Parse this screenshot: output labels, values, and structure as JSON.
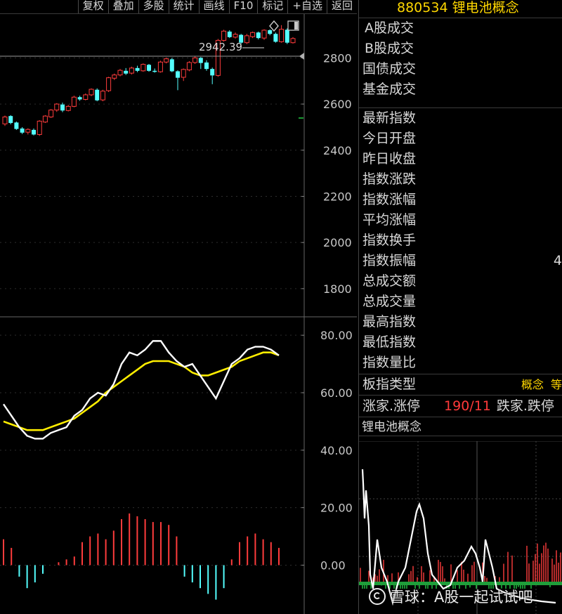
{
  "toolbar": {
    "items": [
      "复权",
      "叠加",
      "多股",
      "统计",
      "画线",
      "F10",
      "标记",
      "+自选",
      "返回"
    ]
  },
  "main_chart": {
    "price_labels": [
      "2800",
      "2600",
      "2400",
      "2200",
      "2000",
      "1800"
    ],
    "high_note": "2942.39",
    "indicator_labels": [
      "80.00",
      "60.00",
      "40.00",
      "20.00",
      "0.00"
    ],
    "colors": {
      "up": "#ff3c3c",
      "down": "#54ffff",
      "line_k": "#ffffff",
      "line_d": "#ffee00"
    }
  },
  "chart_data": {
    "type": "candlestick",
    "price_axis": {
      "ticks": [
        2800,
        2600,
        2400,
        2200,
        2000,
        1800
      ],
      "range": [
        1690,
        2990
      ]
    },
    "price_high_annotation": 2942.39,
    "candles": [
      [
        2514,
        2544,
        2505,
        2550
      ],
      [
        2548,
        2518,
        2512,
        2552
      ],
      [
        2520,
        2492,
        2488,
        2524
      ],
      [
        2494,
        2476,
        2470,
        2500
      ],
      [
        2478,
        2490,
        2468,
        2495
      ],
      [
        2488,
        2468,
        2464,
        2494
      ],
      [
        2468,
        2526,
        2462,
        2530
      ],
      [
        2522,
        2548,
        2518,
        2552
      ],
      [
        2544,
        2574,
        2540,
        2578
      ],
      [
        2574,
        2600,
        2566,
        2604
      ],
      [
        2598,
        2572,
        2565,
        2606
      ],
      [
        2572,
        2590,
        2568,
        2596
      ],
      [
        2590,
        2630,
        2586,
        2636
      ],
      [
        2630,
        2620,
        2614,
        2636
      ],
      [
        2620,
        2640,
        2616,
        2646
      ],
      [
        2640,
        2664,
        2634,
        2668
      ],
      [
        2662,
        2616,
        2612,
        2668
      ],
      [
        2618,
        2656,
        2612,
        2662
      ],
      [
        2658,
        2714,
        2652,
        2718
      ],
      [
        2712,
        2726,
        2704,
        2732
      ],
      [
        2726,
        2746,
        2720,
        2752
      ],
      [
        2744,
        2732,
        2726,
        2756
      ],
      [
        2734,
        2756,
        2728,
        2762
      ],
      [
        2756,
        2744,
        2738,
        2766
      ],
      [
        2744,
        2772,
        2740,
        2776
      ],
      [
        2770,
        2744,
        2740,
        2774
      ],
      [
        2744,
        2740,
        2736,
        2754
      ],
      [
        2740,
        2782,
        2736,
        2788
      ],
      [
        2782,
        2796,
        2776,
        2802
      ],
      [
        2794,
        2742,
        2738,
        2800
      ],
      [
        2742,
        2714,
        2660,
        2746
      ],
      [
        2716,
        2750,
        2700,
        2754
      ],
      [
        2748,
        2780,
        2742,
        2786
      ],
      [
        2780,
        2800,
        2774,
        2806
      ],
      [
        2800,
        2778,
        2752,
        2804
      ],
      [
        2780,
        2752,
        2744,
        2790
      ],
      [
        2752,
        2724,
        2686,
        2758
      ],
      [
        2724,
        2876,
        2718,
        2882
      ],
      [
        2876,
        2916,
        2870,
        2922
      ],
      [
        2914,
        2890,
        2886,
        2920
      ],
      [
        2890,
        2902,
        2884,
        2910
      ],
      [
        2900,
        2866,
        2860,
        2904
      ],
      [
        2866,
        2896,
        2860,
        2904
      ],
      [
        2892,
        2910,
        2886,
        2914
      ],
      [
        2910,
        2886,
        2880,
        2914
      ],
      [
        2886,
        2920,
        2878,
        2924
      ],
      [
        2920,
        2904,
        2898,
        2924
      ],
      [
        2904,
        2870,
        2866,
        2910
      ],
      [
        2870,
        2924,
        2866,
        2942
      ],
      [
        2922,
        2866,
        2860,
        2928
      ],
      [
        2866,
        2884,
        2862,
        2890
      ]
    ],
    "indicator_axis": {
      "ticks": [
        80,
        60,
        40,
        20,
        0
      ],
      "range": [
        -17,
        82
      ]
    },
    "indicator_k": [
      56,
      52,
      48,
      45,
      44,
      44,
      46,
      47,
      48,
      52,
      54,
      58,
      60,
      59,
      63,
      70,
      74,
      73,
      75,
      78,
      78,
      74,
      71,
      69,
      70,
      66,
      62,
      58,
      64,
      70,
      72,
      75,
      76,
      76,
      75,
      73
    ],
    "indicator_d": [
      50,
      49,
      48,
      47,
      47,
      47,
      48,
      49,
      50,
      51,
      53,
      55,
      57,
      60,
      62,
      64,
      66,
      68,
      70,
      71,
      71,
      71,
      70,
      69,
      67,
      66,
      66,
      67,
      68,
      69,
      71,
      72,
      73,
      74,
      74,
      73
    ],
    "indicator_bars": [
      9,
      6,
      -4,
      -8,
      -6,
      -3,
      0,
      1,
      2,
      3,
      8,
      10,
      11,
      9,
      12,
      16,
      18,
      17,
      16,
      15,
      15,
      14,
      10,
      -4,
      -6,
      -8,
      -10,
      -12,
      -8,
      2,
      8,
      10,
      11,
      9,
      8,
      6
    ]
  },
  "panel": {
    "title": "880534 锂电池概念",
    "volume_rows": [
      "A股成交",
      "B股成交",
      "国债成交",
      "基金成交"
    ],
    "index_rows": [
      "最新指数",
      "今日开盘",
      "昨日收盘",
      "指数涨跌",
      "指数涨幅",
      "平均涨幅",
      "指数换手",
      "指数振幅",
      "总成交额",
      "总成交量",
      "最高指数",
      "最低指数",
      "指数量比"
    ],
    "partial_value": "4",
    "type_row": {
      "label": "板指类型",
      "value": "概念",
      "value2": "等"
    },
    "adv_row": {
      "label": "涨家.涨停",
      "value": "190/11",
      "label2": "跌家.跌停"
    },
    "mini_title": "锂电池概念",
    "watermark": "雪球：A股一起试试吧"
  }
}
